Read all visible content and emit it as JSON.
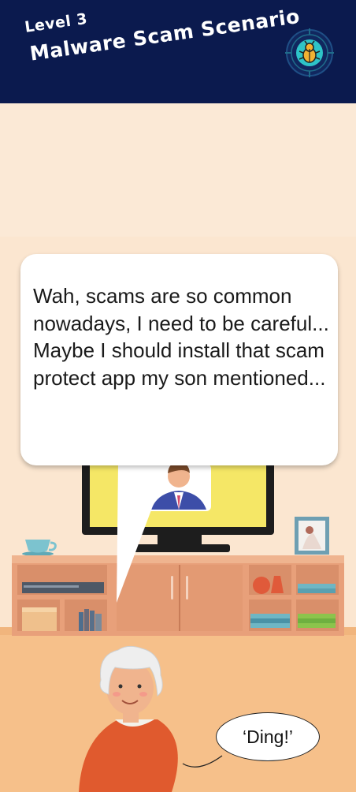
{
  "header": {
    "level_label": "Level 3",
    "title": "Malware Scam Scenario",
    "badge_icon": "bug-icon"
  },
  "dialogue": {
    "text": "Wah, scams are so common nowadays, I need to be careful...\nMaybe I should install that scam protect app my son mentioned..."
  },
  "sound_effect": {
    "text": "‘Ding!’"
  },
  "colors": {
    "header_bg": "#0b1a4e",
    "wall": "#fbe9d6",
    "floor": "#f6c08a",
    "tv_screen": "#f5e766",
    "cabinet": "#e8a07a",
    "badge_accent": "#2ec4c8"
  }
}
